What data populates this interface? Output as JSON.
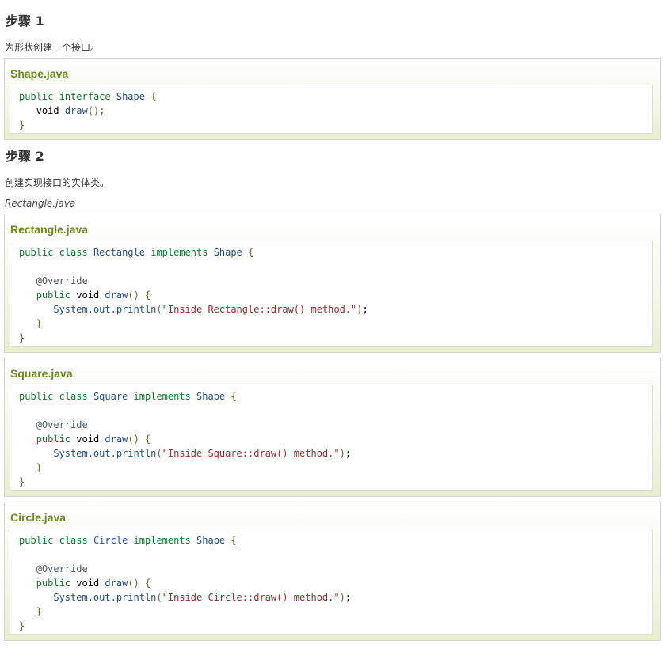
{
  "steps": [
    {
      "heading": "步骤 1",
      "description": "为形状创建一个接口。"
    },
    {
      "heading": "步骤 2",
      "description": "创建实现接口的实体类。",
      "filename": "Rectangle.java"
    }
  ],
  "examples": [
    {
      "title": "Shape.java"
    },
    {
      "title": "Rectangle.java"
    },
    {
      "title": "Square.java"
    },
    {
      "title": "Circle.java"
    }
  ],
  "code": {
    "kw_public": "public",
    "kw_interface": "interface",
    "kw_class": "class",
    "kw_implements": "implements",
    "kw_void": "void",
    "type_shape": "Shape",
    "type_rectangle": "Rectangle",
    "type_square": "Square",
    "type_circle": "Circle",
    "fn_draw": "draw",
    "annotation": "@Override",
    "sys_out": "System.out.println",
    "str_rectangle": "\"Inside Rectangle::draw() method.\"",
    "str_square": "\"Inside Square::draw() method.\"",
    "str_circle": "\"Inside Circle::draw() method.\"",
    "brace_open": "{",
    "brace_close": "}",
    "paren_open": "(",
    "paren_close": ")",
    "semicolon": ";",
    "empty_parens_semicolon": "();"
  }
}
